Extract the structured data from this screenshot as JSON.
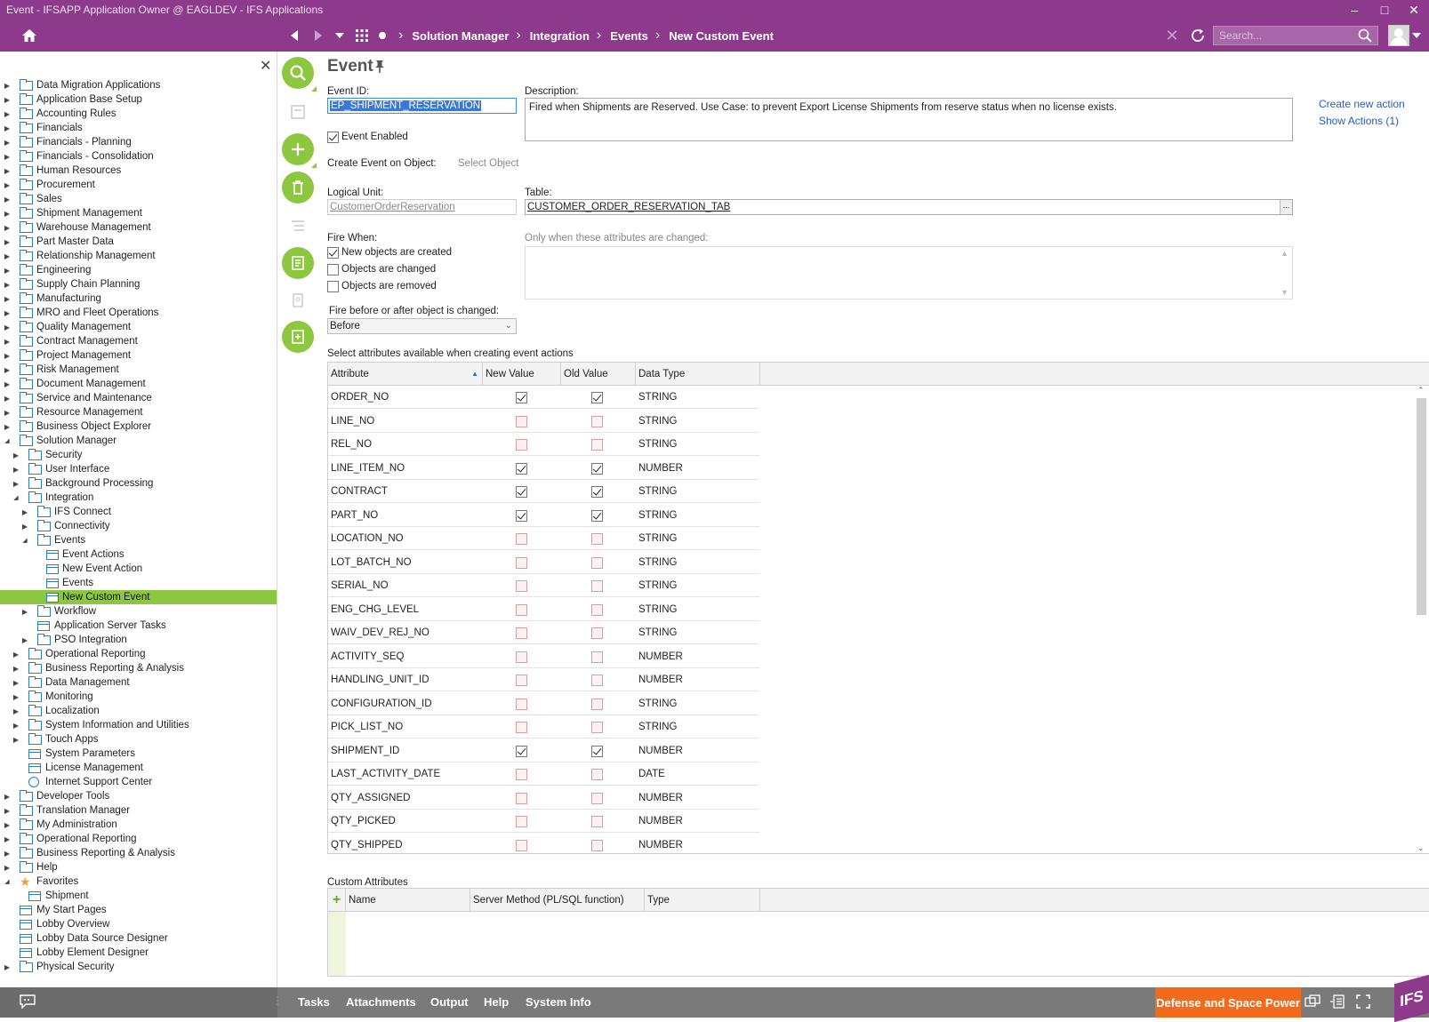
{
  "window": {
    "title": "Event - IFSAPP Application Owner @ EAGLDEV - IFS Applications"
  },
  "nav": {
    "breadcrumbs": [
      "Solution Manager",
      "Integration",
      "Events",
      "New Custom Event"
    ],
    "search_placeholder": "Search..."
  },
  "sidebar": {
    "tree": [
      {
        "label": "Data Migration Applications",
        "level": 0,
        "arrow": "right",
        "icon": "folder"
      },
      {
        "label": "Application Base Setup",
        "level": 0,
        "arrow": "right",
        "icon": "folder"
      },
      {
        "label": "Accounting Rules",
        "level": 0,
        "arrow": "right",
        "icon": "folder"
      },
      {
        "label": "Financials",
        "level": 0,
        "arrow": "right",
        "icon": "folder"
      },
      {
        "label": "Financials - Planning",
        "level": 0,
        "arrow": "right",
        "icon": "folder"
      },
      {
        "label": "Financials - Consolidation",
        "level": 0,
        "arrow": "right",
        "icon": "folder"
      },
      {
        "label": "Human Resources",
        "level": 0,
        "arrow": "right",
        "icon": "folder"
      },
      {
        "label": "Procurement",
        "level": 0,
        "arrow": "right",
        "icon": "folder"
      },
      {
        "label": "Sales",
        "level": 0,
        "arrow": "right",
        "icon": "folder"
      },
      {
        "label": "Shipment Management",
        "level": 0,
        "arrow": "right",
        "icon": "folder"
      },
      {
        "label": "Warehouse Management",
        "level": 0,
        "arrow": "right",
        "icon": "folder"
      },
      {
        "label": "Part Master Data",
        "level": 0,
        "arrow": "right",
        "icon": "folder"
      },
      {
        "label": "Relationship Management",
        "level": 0,
        "arrow": "right",
        "icon": "folder"
      },
      {
        "label": "Engineering",
        "level": 0,
        "arrow": "right",
        "icon": "folder"
      },
      {
        "label": "Supply Chain Planning",
        "level": 0,
        "arrow": "right",
        "icon": "folder"
      },
      {
        "label": "Manufacturing",
        "level": 0,
        "arrow": "right",
        "icon": "folder"
      },
      {
        "label": "MRO and Fleet Operations",
        "level": 0,
        "arrow": "right",
        "icon": "folder"
      },
      {
        "label": "Quality Management",
        "level": 0,
        "arrow": "right",
        "icon": "folder"
      },
      {
        "label": "Contract Management",
        "level": 0,
        "arrow": "right",
        "icon": "folder"
      },
      {
        "label": "Project Management",
        "level": 0,
        "arrow": "right",
        "icon": "folder"
      },
      {
        "label": "Risk Management",
        "level": 0,
        "arrow": "right",
        "icon": "folder"
      },
      {
        "label": "Document Management",
        "level": 0,
        "arrow": "right",
        "icon": "folder"
      },
      {
        "label": "Service and Maintenance",
        "level": 0,
        "arrow": "right",
        "icon": "folder"
      },
      {
        "label": "Resource Management",
        "level": 0,
        "arrow": "right",
        "icon": "folder"
      },
      {
        "label": "Business Object Explorer",
        "level": 0,
        "arrow": "right",
        "icon": "folder"
      },
      {
        "label": "Solution Manager",
        "level": 0,
        "arrow": "down",
        "icon": "folder"
      },
      {
        "label": "Security",
        "level": 1,
        "arrow": "right",
        "icon": "folder"
      },
      {
        "label": "User Interface",
        "level": 1,
        "arrow": "right",
        "icon": "folder"
      },
      {
        "label": "Background Processing",
        "level": 1,
        "arrow": "right",
        "icon": "folder"
      },
      {
        "label": "Integration",
        "level": 1,
        "arrow": "down",
        "icon": "folder"
      },
      {
        "label": "IFS Connect",
        "level": 2,
        "arrow": "right",
        "icon": "folder"
      },
      {
        "label": "Connectivity",
        "level": 2,
        "arrow": "right",
        "icon": "folder"
      },
      {
        "label": "Events",
        "level": 2,
        "arrow": "down",
        "icon": "folder"
      },
      {
        "label": "Event Actions",
        "level": 3,
        "arrow": "",
        "icon": "page"
      },
      {
        "label": "New Event Action",
        "level": 3,
        "arrow": "",
        "icon": "page"
      },
      {
        "label": "Events",
        "level": 3,
        "arrow": "",
        "icon": "page"
      },
      {
        "label": "New Custom Event",
        "level": 3,
        "arrow": "",
        "icon": "page",
        "selected": true
      },
      {
        "label": "Workflow",
        "level": 2,
        "arrow": "right",
        "icon": "folder"
      },
      {
        "label": "Application Server Tasks",
        "level": 2,
        "arrow": "",
        "icon": "page"
      },
      {
        "label": "PSO Integration",
        "level": 2,
        "arrow": "right",
        "icon": "folder"
      },
      {
        "label": "Operational Reporting",
        "level": 1,
        "arrow": "right",
        "icon": "folder"
      },
      {
        "label": "Business Reporting & Analysis",
        "level": 1,
        "arrow": "right",
        "icon": "folder"
      },
      {
        "label": "Data Management",
        "level": 1,
        "arrow": "right",
        "icon": "folder"
      },
      {
        "label": "Monitoring",
        "level": 1,
        "arrow": "right",
        "icon": "folder"
      },
      {
        "label": "Localization",
        "level": 1,
        "arrow": "right",
        "icon": "folder"
      },
      {
        "label": "System Information and Utilities",
        "level": 1,
        "arrow": "right",
        "icon": "folder"
      },
      {
        "label": "Touch Apps",
        "level": 1,
        "arrow": "right",
        "icon": "folder"
      },
      {
        "label": "System Parameters",
        "level": 1,
        "arrow": "",
        "icon": "page"
      },
      {
        "label": "License Management",
        "level": 1,
        "arrow": "",
        "icon": "page"
      },
      {
        "label": "Internet Support Center",
        "level": 1,
        "arrow": "",
        "icon": "globe"
      },
      {
        "label": "Developer Tools",
        "level": 0,
        "arrow": "right",
        "icon": "folder"
      },
      {
        "label": "Translation Manager",
        "level": 0,
        "arrow": "right",
        "icon": "folder"
      },
      {
        "label": "My Administration",
        "level": 0,
        "arrow": "right",
        "icon": "folder"
      },
      {
        "label": "Operational Reporting",
        "level": 0,
        "arrow": "right",
        "icon": "folder"
      },
      {
        "label": "Business Reporting & Analysis",
        "level": 0,
        "arrow": "right",
        "icon": "folder"
      },
      {
        "label": "Help",
        "level": 0,
        "arrow": "right",
        "icon": "folder"
      },
      {
        "label": "Favorites",
        "level": 0,
        "arrow": "down",
        "icon": "star"
      },
      {
        "label": "Shipment",
        "level": 1,
        "arrow": "",
        "icon": "page"
      },
      {
        "label": "My Start Pages",
        "level": 0,
        "arrow": "",
        "icon": "page"
      },
      {
        "label": "Lobby Overview",
        "level": 0,
        "arrow": "",
        "icon": "page"
      },
      {
        "label": "Lobby Data Source Designer",
        "level": 0,
        "arrow": "",
        "icon": "page"
      },
      {
        "label": "Lobby Element Designer",
        "level": 0,
        "arrow": "",
        "icon": "page"
      },
      {
        "label": "Physical Security",
        "level": 0,
        "arrow": "right",
        "icon": "folder"
      }
    ]
  },
  "form": {
    "title": "Event",
    "event_id_label": "Event ID:",
    "event_id_value": "EP_SHIPMENT_RESERVATION",
    "description_label": "Description:",
    "description_value": "Fired when Shipments are Reserved. Use Case: to prevent Export License Shipments from reserve status when no license exists.",
    "event_enabled_label": "Event Enabled",
    "event_enabled": true,
    "create_on_object_label": "Create Event on Object:",
    "select_object_label": "Select Object",
    "logical_unit_label": "Logical Unit:",
    "logical_unit_value": "CustomerOrderReservation",
    "table_label": "Table:",
    "table_value": "CUSTOMER_ORDER_RESERVATION_TAB",
    "table_lov_label": "...",
    "fire_when_label": "Fire When:",
    "fire_options": [
      {
        "label": "New objects are created",
        "checked": true
      },
      {
        "label": "Objects are changed",
        "checked": false
      },
      {
        "label": "Objects are removed",
        "checked": false
      }
    ],
    "only_when_label": "Only when these attributes are changed:",
    "fire_before_after_label": "Fire before or after object is changed:",
    "fire_before_after_value": "Before",
    "create_action_link": "Create new action",
    "show_actions_link": "Show Actions (1)"
  },
  "attributes_grid": {
    "caption": "Select attributes available when creating event actions",
    "columns": [
      "Attribute",
      "New Value",
      "Old Value",
      "Data Type"
    ],
    "rows": [
      {
        "attribute": "ORDER_NO",
        "new": true,
        "old": true,
        "type": "STRING"
      },
      {
        "attribute": "LINE_NO",
        "new": false,
        "old": false,
        "type": "STRING"
      },
      {
        "attribute": "REL_NO",
        "new": false,
        "old": false,
        "type": "STRING"
      },
      {
        "attribute": "LINE_ITEM_NO",
        "new": true,
        "old": true,
        "type": "NUMBER"
      },
      {
        "attribute": "CONTRACT",
        "new": true,
        "old": true,
        "type": "STRING"
      },
      {
        "attribute": "PART_NO",
        "new": true,
        "old": true,
        "type": "STRING"
      },
      {
        "attribute": "LOCATION_NO",
        "new": false,
        "old": false,
        "type": "STRING"
      },
      {
        "attribute": "LOT_BATCH_NO",
        "new": false,
        "old": false,
        "type": "STRING"
      },
      {
        "attribute": "SERIAL_NO",
        "new": false,
        "old": false,
        "type": "STRING"
      },
      {
        "attribute": "ENG_CHG_LEVEL",
        "new": false,
        "old": false,
        "type": "STRING"
      },
      {
        "attribute": "WAIV_DEV_REJ_NO",
        "new": false,
        "old": false,
        "type": "STRING"
      },
      {
        "attribute": "ACTIVITY_SEQ",
        "new": false,
        "old": false,
        "type": "NUMBER"
      },
      {
        "attribute": "HANDLING_UNIT_ID",
        "new": false,
        "old": false,
        "type": "NUMBER"
      },
      {
        "attribute": "CONFIGURATION_ID",
        "new": false,
        "old": false,
        "type": "STRING"
      },
      {
        "attribute": "PICK_LIST_NO",
        "new": false,
        "old": false,
        "type": "STRING"
      },
      {
        "attribute": "SHIPMENT_ID",
        "new": true,
        "old": true,
        "type": "NUMBER"
      },
      {
        "attribute": "LAST_ACTIVITY_DATE",
        "new": false,
        "old": false,
        "type": "DATE"
      },
      {
        "attribute": "QTY_ASSIGNED",
        "new": false,
        "old": false,
        "type": "NUMBER"
      },
      {
        "attribute": "QTY_PICKED",
        "new": false,
        "old": false,
        "type": "NUMBER"
      },
      {
        "attribute": "QTY_SHIPPED",
        "new": false,
        "old": false,
        "type": "NUMBER"
      }
    ]
  },
  "custom_attributes": {
    "caption": "Custom Attributes",
    "columns": [
      "Name",
      "Server Method (PL/SQL function)",
      "Type"
    ]
  },
  "bottombar": {
    "items": [
      "Tasks",
      "Attachments",
      "Output",
      "Help",
      "System Info"
    ],
    "environment": "Defense and Space Power",
    "brand_color": "#8d3a8d",
    "accent_color": "#8dc63f"
  },
  "logo_text": "IFS"
}
